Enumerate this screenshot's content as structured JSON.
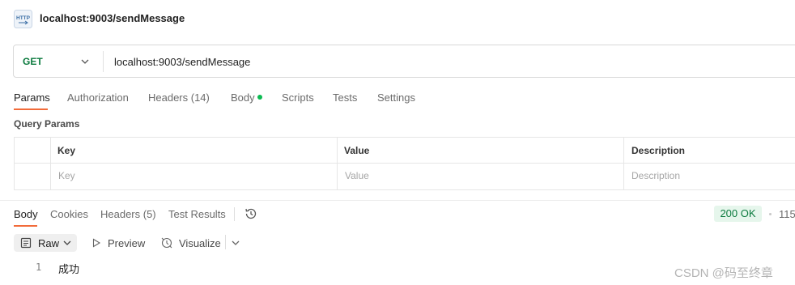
{
  "request": {
    "icon": "http-icon",
    "title": "localhost:9003/sendMessage",
    "method": "GET",
    "url": "localhost:9003/sendMessage"
  },
  "request_tabs": [
    {
      "label": "Params",
      "active": true
    },
    {
      "label": "Authorization"
    },
    {
      "label": "Headers (14)"
    },
    {
      "label": "Body"
    },
    {
      "label": "Scripts"
    },
    {
      "label": "Tests"
    },
    {
      "label": "Settings"
    }
  ],
  "query_params": {
    "label": "Query Params",
    "headers": [
      "Key",
      "Value",
      "Description"
    ],
    "placeholders": [
      "Key",
      "Value",
      "Description"
    ]
  },
  "response_tabs": [
    {
      "label": "Body",
      "active": true
    },
    {
      "label": "Cookies"
    },
    {
      "label": "Headers (5)"
    },
    {
      "label": "Test Results"
    }
  ],
  "response_status": {
    "status": "200 OK",
    "time_partial": "115",
    "status_color": "#0b7a3e"
  },
  "response_toolbar": {
    "format": "Raw",
    "preview": "Preview",
    "visualize": "Visualize"
  },
  "response_body": {
    "lines": [
      {
        "number": "1",
        "text": "成功"
      }
    ]
  },
  "watermark": "CSDN @码至终章",
  "colors": {
    "accent": "#f26b3a",
    "get_method": "#0b7a3e",
    "body_dot": "#0cbb52"
  }
}
